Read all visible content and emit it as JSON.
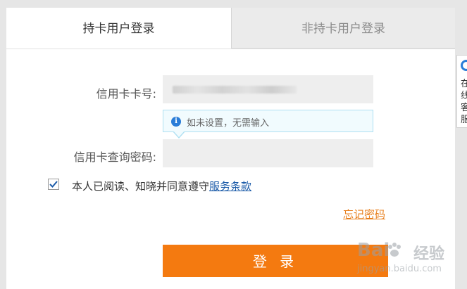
{
  "tabs": {
    "card_holder": "持卡用户登录",
    "non_card_holder": "非持卡用户登录"
  },
  "form": {
    "card_number_label": "信用卡卡号:",
    "card_number_value": "",
    "password_label": "信用卡查询密码:",
    "password_value": ""
  },
  "tooltip": {
    "icon": "info-icon",
    "text": "如未设置，无需输入"
  },
  "agreement": {
    "checked": true,
    "text": "本人已阅读、知晓并同意遵守",
    "link_text": "服务条款"
  },
  "forgot_password": "忘记密码",
  "login_button": "登 录",
  "side_widget": {
    "icon": "headset-icon",
    "text": "在线客服"
  },
  "watermark": {
    "logo": "Bai",
    "logo_cn": "经验",
    "url": "jingyan.baidu.com"
  },
  "colors": {
    "accent": "#f47a10",
    "link": "#1a5aa8",
    "forgot": "#e87f1c",
    "info": "#2a7dd8"
  }
}
